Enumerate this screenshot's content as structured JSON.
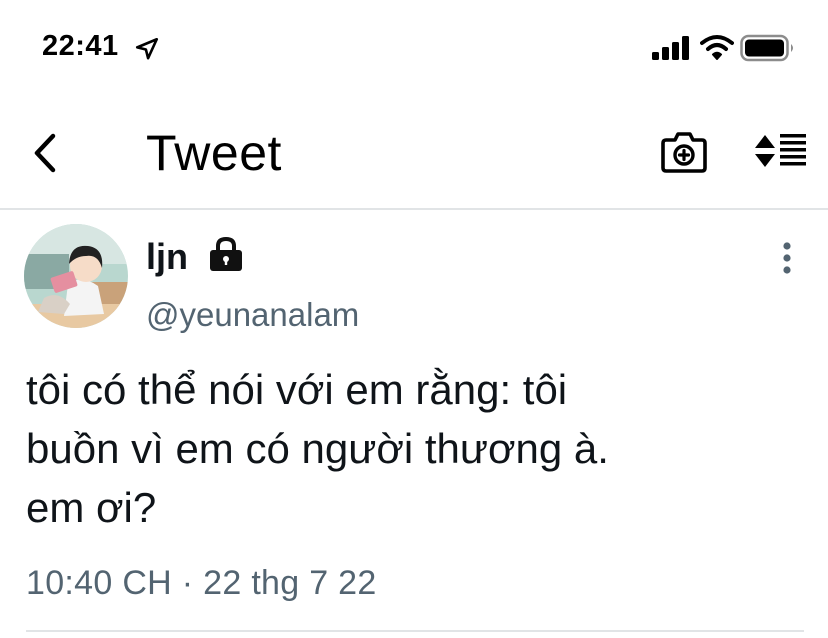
{
  "status_bar": {
    "time": "22:41",
    "icons": [
      "location-arrow-icon",
      "cellular-signal-icon",
      "wifi-icon",
      "battery-icon"
    ]
  },
  "nav": {
    "title": "Tweet",
    "back_icon": "chevron-left-icon",
    "camera_icon": "camera-plus-icon",
    "sort_icon": "sort-list-icon"
  },
  "tweet": {
    "display_name": "ljn",
    "handle": "@yeunanalam",
    "protected_icon": "lock-icon",
    "more_icon": "more-vertical-icon",
    "text": "tôi có thể nói với em rằng: tôi\nbuồn vì em có người thương à.\nem ơi?",
    "timestamp": "10:40 CH · 22 thg 7 22"
  },
  "colors": {
    "text_primary": "#0f1419",
    "text_secondary": "#536471",
    "divider": "#e1e4e6"
  }
}
